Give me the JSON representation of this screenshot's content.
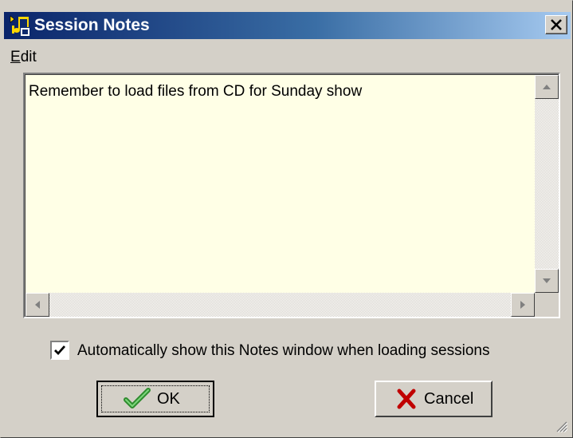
{
  "window": {
    "title": "Session Notes",
    "icon": "session-notes-app-icon"
  },
  "menubar": {
    "edit_label": "Edit",
    "edit_mnemonic": "E",
    "edit_rest": "dit"
  },
  "notes": {
    "text": "Remember to load files from CD for Sunday show"
  },
  "options": {
    "auto_show_label": "Automatically show this Notes window when loading sessions",
    "auto_show_checked": true
  },
  "buttons": {
    "ok_label": "OK",
    "ok_icon": "checkmark-icon",
    "cancel_label": "Cancel",
    "cancel_icon": "red-x-icon"
  },
  "colors": {
    "title_gradient_start": "#0a246a",
    "title_gradient_end": "#a6caf0",
    "notes_background": "#ffffe6",
    "dialog_face": "#d4d0c8"
  }
}
